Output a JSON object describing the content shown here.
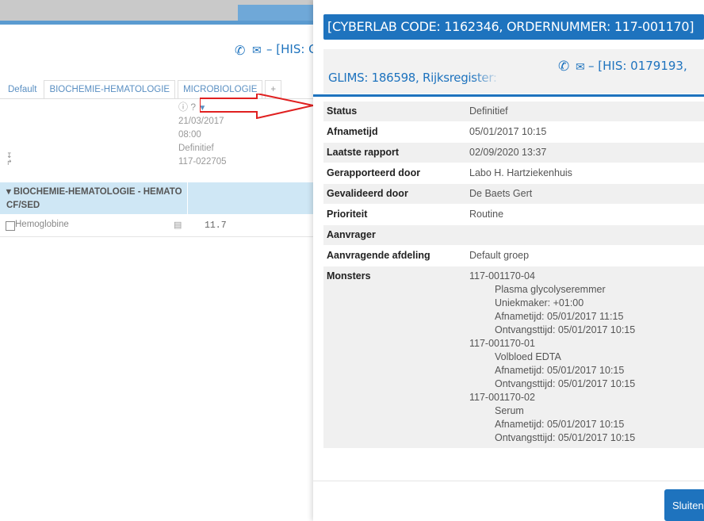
{
  "background": {
    "header": {
      "his_text": "– [HIS: C"
    },
    "tabs": [
      "Default",
      "BIOCHEMIE-HEMATOLOGIE",
      "MICROBIOLOGIE",
      "+"
    ],
    "column": {
      "date": "21/03/2017",
      "time": "08:00",
      "status": "Definitief",
      "order": "117-022705"
    },
    "group": {
      "label": "BIOCHEMIE-HEMATOLOGIE - HEMATO CF/SED"
    },
    "rows": [
      {
        "label": "Hemoglobine",
        "value": "11.7"
      }
    ]
  },
  "modal": {
    "title": "[CYBERLAB CODE: 1162346, ORDERNUMMER: 117-001170]",
    "header": {
      "his_text": "– [HIS: 0179193,",
      "glims_text": "GLIMS: 186598, Rijksregister:"
    },
    "details": [
      {
        "key": "Status",
        "value": "Definitief"
      },
      {
        "key": "Afnametijd",
        "value": "05/01/2017 10:15"
      },
      {
        "key": "Laatste rapport",
        "value": "02/09/2020 13:37"
      },
      {
        "key": "Gerapporteerd door",
        "value": "Labo H. Hartziekenhuis"
      },
      {
        "key": "Gevalideerd door",
        "value": "De Baets Gert"
      },
      {
        "key": "Prioriteit",
        "value": "Routine"
      },
      {
        "key": "Aanvrager",
        "value": ""
      },
      {
        "key": "Aanvragende afdeling",
        "value": "Default groep"
      }
    ],
    "monsters": {
      "key": "Monsters",
      "samples": [
        {
          "id": "117-001170-04",
          "lines": [
            "Plasma glycolyseremmer",
            "Uniekmaker: +01:00",
            "Afnametijd: 05/01/2017 11:15",
            "Ontvangsttijd: 05/01/2017 10:15"
          ]
        },
        {
          "id": "117-001170-01",
          "lines": [
            "Volbloed EDTA",
            "Afnametijd: 05/01/2017 10:15",
            "Ontvangsttijd: 05/01/2017 10:15"
          ]
        },
        {
          "id": "117-001170-02",
          "lines": [
            "Serum",
            "Afnametijd: 05/01/2017 10:15",
            "Ontvangsttijd: 05/01/2017 10:15"
          ]
        }
      ]
    },
    "close_label": "Sluiten"
  },
  "colors": {
    "primary": "#1e73be",
    "group_bg": "#cfe7f5",
    "arrow": "#e02020"
  },
  "icons": {
    "phone": "phone-icon",
    "mail": "envelope-icon",
    "info": "info-icon",
    "help": "question-icon",
    "sort": "triangle-down-icon",
    "chart": "chart-icon"
  }
}
